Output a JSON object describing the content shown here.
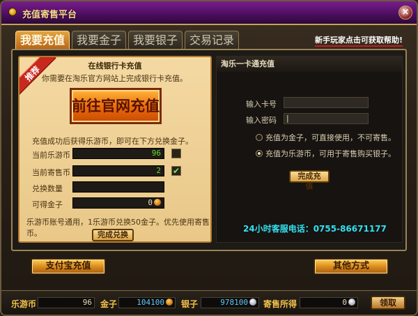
{
  "window": {
    "title": "充值寄售平台",
    "close": "×"
  },
  "tabs": [
    {
      "label": "我要充值",
      "active": true
    },
    {
      "label": "我要金子",
      "active": false
    },
    {
      "label": "我要银子",
      "active": false
    },
    {
      "label": "交易记录",
      "active": false
    }
  ],
  "help_link": "新手玩家点击可获取帮助!",
  "bank_panel": {
    "ribbon": "推荐",
    "title": "在线银行卡充值",
    "hint": "你需要在淘乐官方网站上完成银行卡充值。",
    "official_button": "前往官网充值",
    "note": "充值成功后获得乐游币，即可在下方兑换金子。",
    "rows": [
      {
        "label": "当前乐游币",
        "value": "96",
        "checked": false
      },
      {
        "label": "当前寄售币",
        "value": "2",
        "checked": true
      },
      {
        "label": "兑换数量",
        "value": ""
      },
      {
        "label": "可得金子",
        "value": "0"
      }
    ],
    "footnote": "乐游币账号通用，1乐游币兑换50金子。优先使用寄售币。",
    "exchange_button": "完成兑换"
  },
  "card_panel": {
    "title": "淘乐一卡通充值",
    "card_label": "输入卡号",
    "card_value": "",
    "password_label": "输入密码",
    "password_value": "|",
    "radio_gold": "充值为金子，可直接使用，不可寄售。",
    "radio_coin": "充值为乐游币，可用于寄售购买银子。",
    "radio_gold_selected": false,
    "radio_coin_selected": true,
    "submit_button": "完成充值",
    "hotline": "24小时客服电话：0755-86671177"
  },
  "buttons": {
    "alipay": "支付宝充值",
    "other": "其他方式"
  },
  "footer": {
    "coin_label": "乐游币",
    "coin_value": "96",
    "gold_label": "金子",
    "gold_value": "104100",
    "silver_label": "银子",
    "silver_value": "978100",
    "consign_label": "寄售所得",
    "consign_value": "0",
    "claim_button": "领取"
  },
  "colors": {
    "accent": "#f2c24a",
    "title_bar": "#5a1470",
    "hotline": "#33e0f0"
  }
}
